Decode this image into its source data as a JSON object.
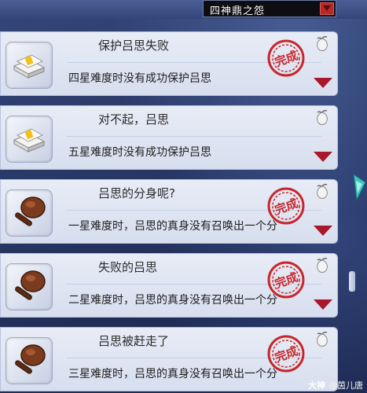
{
  "dropdown": {
    "selected": "四神鼎之怨"
  },
  "achievements": [
    {
      "title": "保护吕思失败",
      "description": "四星难度时没有成功保护吕思",
      "icon": "paper-stack-icon",
      "completed": true
    },
    {
      "title": "对不起，吕思",
      "description": "五星难度时没有成功保护吕思",
      "icon": "paper-stack-icon",
      "completed": false
    },
    {
      "title": "吕思的分身呢?",
      "description": "一星难度时，吕思的真身没有召唤出一个分",
      "icon": "drum-mallet-icon",
      "completed": true
    },
    {
      "title": "失败的吕思",
      "description": "二星难度时，吕思的真身没有召唤出一个分",
      "icon": "drum-mallet-icon",
      "completed": true
    },
    {
      "title": "吕思被赶走了",
      "description": "三星难度时，吕思的真身没有召唤出一个分",
      "icon": "drum-mallet-icon",
      "completed": true
    }
  ],
  "stamp_text": "完成",
  "watermark": {
    "brand": "大神",
    "user": "@茵儿唐"
  },
  "colors": {
    "stamp": "#c8262a",
    "arrow": "#a8182a",
    "card": "#e3e8f3"
  }
}
